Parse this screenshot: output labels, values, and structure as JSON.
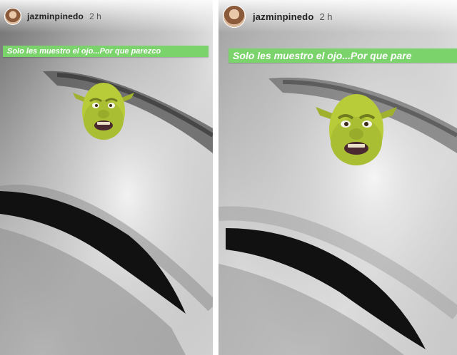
{
  "stories": [
    {
      "username": "jazminpinedo",
      "time": "2 h",
      "caption": "Solo les muestro el ojo...Por que parezco"
    },
    {
      "username": "jazminpinedo",
      "time": "2 h",
      "caption": "Solo les muestro el ojo...Por que pare"
    }
  ],
  "colors": {
    "caption_bg": "#7bd36c",
    "sticker_green": "#b8cc3a"
  },
  "icons": {
    "avatar": "profile-avatar-icon",
    "sticker": "ogre-face-sticker-icon"
  }
}
